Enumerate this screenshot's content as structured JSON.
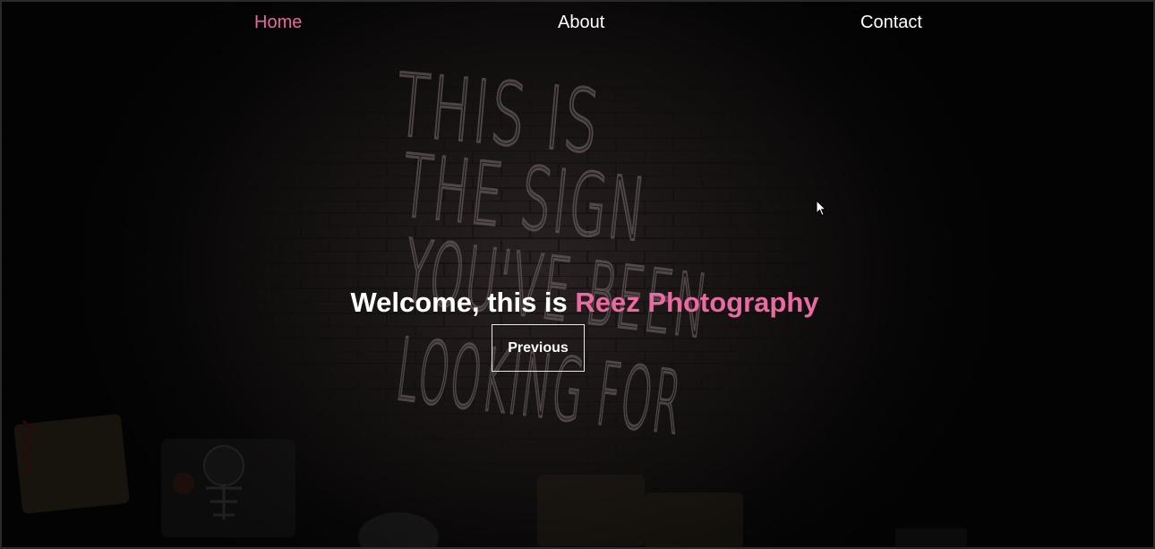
{
  "nav": {
    "items": [
      {
        "label": "Home",
        "active": true
      },
      {
        "label": "About",
        "active": false
      },
      {
        "label": "Contact",
        "active": false
      }
    ]
  },
  "hero": {
    "headline_prefix": "Welcome, this is ",
    "headline_brand": "Reez Photography",
    "sign_lines": [
      "THIS IS",
      "THE SIGN",
      "YOU'VE BEEN",
      "LOOKING FOR"
    ],
    "previous_button": "Previous"
  },
  "colors": {
    "accent": "#e9659f",
    "text": "#ffffff",
    "background": "#050505"
  },
  "icons": {
    "cursor": "mouse-pointer-icon"
  }
}
